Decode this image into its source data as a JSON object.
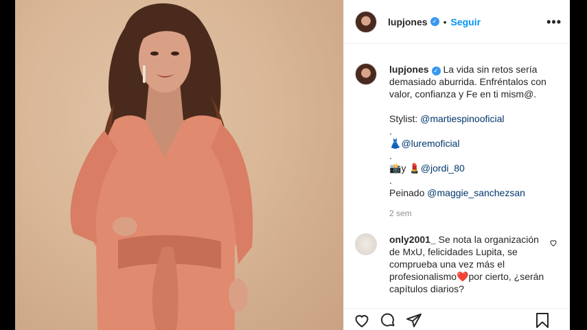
{
  "header": {
    "username": "lupjones",
    "separator": "•",
    "follow_label": "Seguir",
    "more_label": "•••"
  },
  "caption": {
    "username": "lupjones",
    "line1": "La vida sin retos sería demasiado aburrida. Enfréntalos con valor, confianza y Fe en ti mism@.",
    "stylist_prefix": "Stylist: ",
    "stylist_tag": "@martiespinooficial",
    "dot1": ".",
    "dress_emoji": "👗",
    "tag2": "@luremoficial",
    "dot2": ".",
    "camera_emoji": "📸",
    "y": "y ",
    "lipstick_emoji": "💄",
    "tag3": "@jordi_80",
    "dot3": ".",
    "peinado_prefix": "Peinado ",
    "tag4": "@maggie_sanchezsan",
    "time_ago": "2 sem"
  },
  "comment": {
    "username": "only2001_",
    "text_a": " Se nota la organización de MxU, felicidades Lupita, se comprueba una vez más el profesionalismo",
    "heart_emoji": "❤️",
    "text_b": "por cierto, ¿serán capítulos diarios?"
  },
  "icons": [
    "like-icon",
    "comment-icon",
    "share-icon",
    "save-icon",
    "verified-badge-icon",
    "more-options-icon",
    "comment-like-icon"
  ],
  "colors": {
    "link": "#00376b",
    "follow": "#0095f6",
    "verified": "#3897f0",
    "muted": "#8e8e8e"
  }
}
